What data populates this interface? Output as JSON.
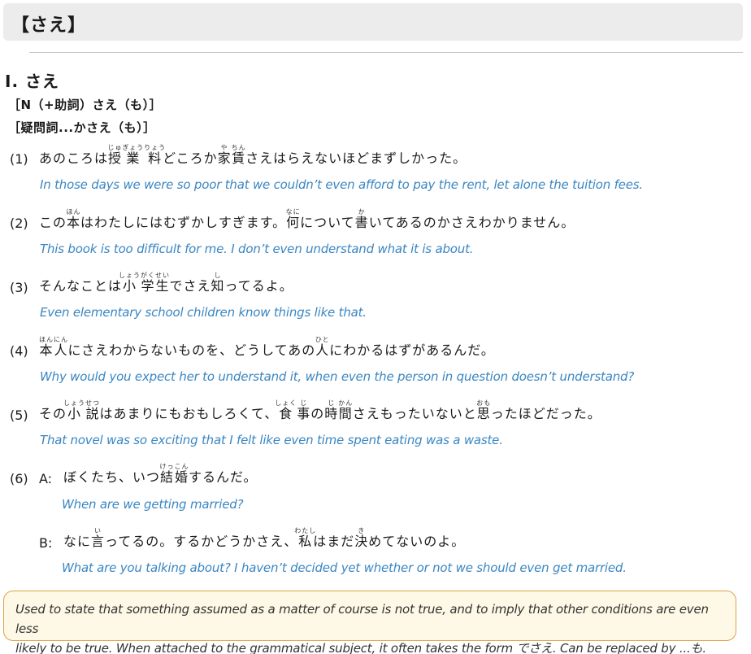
{
  "title": "【さえ】",
  "section": {
    "heading": "Ⅰ. さえ",
    "patterns": [
      "［N（+助詞）さえ（も）］",
      "［疑問詞...かさえ（も）］"
    ]
  },
  "examples": [
    {
      "num": "(1)",
      "jp_segments": [
        {
          "t": "あのころは"
        },
        {
          "t": "授",
          "r": "じゅ"
        },
        {
          "t": "業",
          "r": "ぎょう"
        },
        {
          "t": "料",
          "r": "りょう"
        },
        {
          "t": "どころか"
        },
        {
          "t": "家",
          "r": "や"
        },
        {
          "t": "賃",
          "r": "ちん"
        },
        {
          "t": "さえはらえないほどまずしかった。"
        }
      ],
      "en": "In those days we were so poor that we couldn’t even afford to pay the rent, let alone the tuition fees."
    },
    {
      "num": "(2)",
      "jp_segments": [
        {
          "t": "この"
        },
        {
          "t": "本",
          "r": "ほん"
        },
        {
          "t": "はわたしにはむずかしすぎます。"
        },
        {
          "t": "何",
          "r": "なに"
        },
        {
          "t": "について"
        },
        {
          "t": "書",
          "r": "か"
        },
        {
          "t": "いてあるのかさえわかりません。"
        }
      ],
      "en": "This book is too difficult for me. I don’t even understand what it is about."
    },
    {
      "num": "(3)",
      "jp_segments": [
        {
          "t": "そんなことは"
        },
        {
          "t": "小",
          "r": "しょう"
        },
        {
          "t": "学",
          "r": "がく"
        },
        {
          "t": "生",
          "r": "せい"
        },
        {
          "t": "でさえ"
        },
        {
          "t": "知",
          "r": "し"
        },
        {
          "t": "ってるよ。"
        }
      ],
      "en": "Even elementary school children know things like that."
    },
    {
      "num": "(4)",
      "jp_segments": [
        {
          "t": "本",
          "r": "ほん"
        },
        {
          "t": "人",
          "r": "にん"
        },
        {
          "t": "にさえわからないものを、どうしてあの"
        },
        {
          "t": "人",
          "r": "ひと"
        },
        {
          "t": "にわかるはずがあるんだ。"
        }
      ],
      "en": "Why would you expect her to understand it, when even the person in question doesn’t understand?"
    },
    {
      "num": "(5)",
      "jp_segments": [
        {
          "t": "その"
        },
        {
          "t": "小",
          "r": "しょう"
        },
        {
          "t": "説",
          "r": "せつ"
        },
        {
          "t": "はあまりにもおもしろくて、"
        },
        {
          "t": "食",
          "r": "しょく"
        },
        {
          "t": "事",
          "r": "じ"
        },
        {
          "t": "の"
        },
        {
          "t": "時",
          "r": "じ"
        },
        {
          "t": "間",
          "r": "かん"
        },
        {
          "t": "さえもったいないと"
        },
        {
          "t": "思",
          "r": "おも"
        },
        {
          "t": "ったほどだった。"
        }
      ],
      "en": "That novel was so exciting that I felt like even time spent eating was a waste."
    }
  ],
  "dialogue": {
    "num": "(6)",
    "lines": [
      {
        "speaker": "A:",
        "jp_segments": [
          {
            "t": "ぼくたち、いつ"
          },
          {
            "t": "結",
            "r": "けっ"
          },
          {
            "t": "婚",
            "r": "こん"
          },
          {
            "t": "するんだ。"
          }
        ],
        "en": "When are we getting married?"
      },
      {
        "speaker": "B:",
        "jp_segments": [
          {
            "t": "なに"
          },
          {
            "t": "言",
            "r": "い"
          },
          {
            "t": "ってるの。するかどうかさえ、"
          },
          {
            "t": "私",
            "r": "わたし"
          },
          {
            "t": "はまだ"
          },
          {
            "t": "決",
            "r": "き"
          },
          {
            "t": "めてないのよ。"
          }
        ],
        "en": "What are you talking about? I haven’t decided yet whether or not we should even get married."
      }
    ]
  },
  "note": {
    "line1": "Used to state that something assumed as a matter of course is not true, and to imply that other conditions are even less",
    "line2": "likely to be true. When attached to the grammatical subject, it often takes the form でさえ. Can be replaced by ...も."
  },
  "colors": {
    "english": "#3a86c2",
    "title_bar": "#ececec",
    "note_border": "#e0a24a",
    "note_bg": "#fdf9e6"
  }
}
